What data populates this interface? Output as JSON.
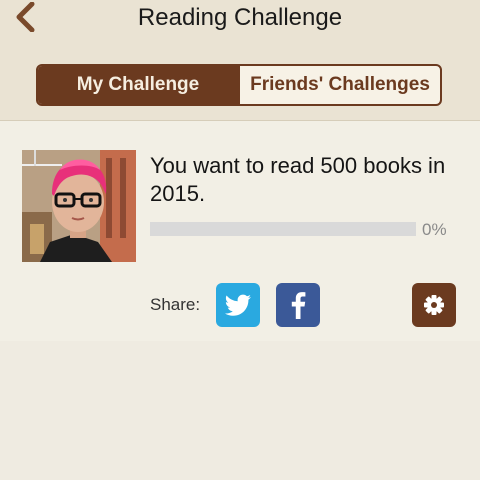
{
  "header": {
    "title": "Reading Challenge",
    "back_icon": "chevron-left-icon"
  },
  "tabs": [
    {
      "label": "My Challenge",
      "active": true
    },
    {
      "label": "Friends' Challenges",
      "active": false
    }
  ],
  "challenge": {
    "goal_text": "You want to read 500 books in 2015.",
    "progress_percent": 0,
    "progress_label": "0%"
  },
  "share": {
    "label": "Share:",
    "buttons": [
      {
        "icon": "twitter-icon"
      },
      {
        "icon": "facebook-icon"
      }
    ]
  },
  "settings_icon": "gear-icon",
  "colors": {
    "brand_brown": "#6b3a1f",
    "twitter_blue": "#2aa9e0",
    "facebook_blue": "#3b5998",
    "background": "#efebe1"
  }
}
